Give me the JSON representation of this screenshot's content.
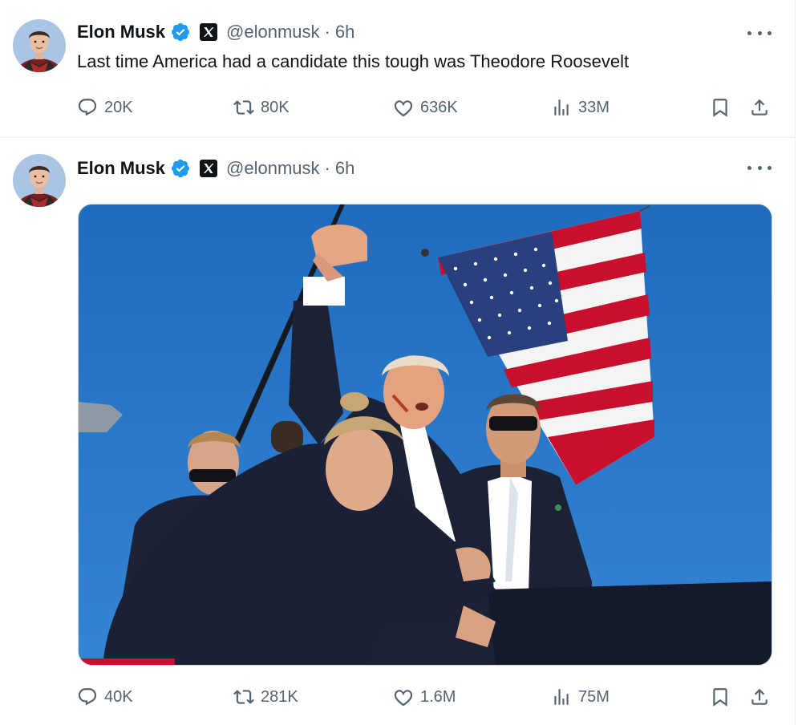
{
  "tweets": [
    {
      "author_name": "Elon Musk",
      "handle": "@elonmusk",
      "separator": "·",
      "time": "6h",
      "text": "Last time America had a candidate this tough was Theodore Roosevelt",
      "stats": {
        "replies": "20K",
        "reposts": "80K",
        "likes": "636K",
        "views": "33M"
      }
    },
    {
      "author_name": "Elon Musk",
      "handle": "@elonmusk",
      "separator": "·",
      "time": "6h",
      "stats": {
        "replies": "40K",
        "reposts": "281K",
        "likes": "1.6M",
        "views": "75M"
      }
    }
  ],
  "colors": {
    "verified": "#1d9bf0",
    "muted": "#536471",
    "sky": "#2673c2",
    "flag_red": "#c8102e",
    "flag_blue": "#2a3f7e"
  },
  "icons": [
    "verified-badge-icon",
    "x-logo-icon",
    "more-icon",
    "reply-icon",
    "repost-icon",
    "like-icon",
    "views-icon",
    "bookmark-icon",
    "share-icon"
  ]
}
